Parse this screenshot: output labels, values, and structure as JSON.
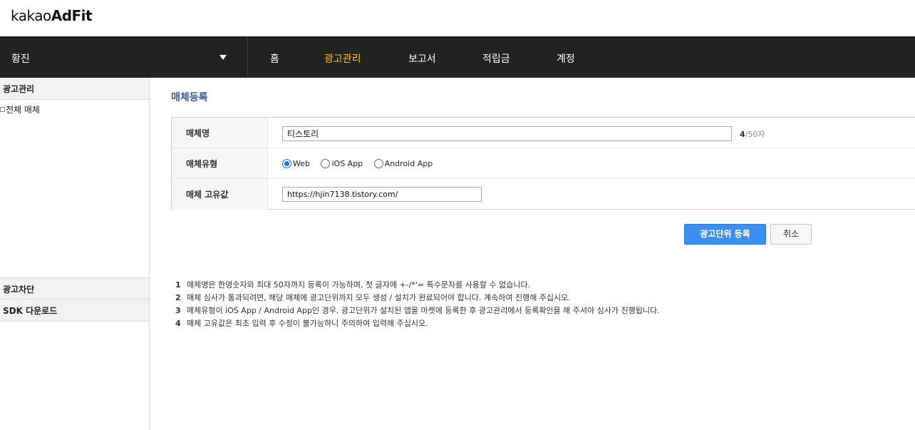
{
  "logo": {
    "prefix": "kakao",
    "brand": "AdFit"
  },
  "nav": {
    "account_name": "황진",
    "items": [
      {
        "label": "홈"
      },
      {
        "label": "광고관리",
        "active": true
      },
      {
        "label": "보고서"
      },
      {
        "label": "적립금"
      },
      {
        "label": "계정"
      }
    ],
    "active_color": "#f5c518"
  },
  "sidebar": {
    "section_ad_manage": "광고관리",
    "tree_all_media": "전체 매체",
    "section_ad_block": "광고차단",
    "section_sdk": "SDK 다운로드"
  },
  "main": {
    "page_title": "매체등록",
    "form": {
      "media_name_label": "매체명",
      "media_name_value": "티스토리",
      "counter_current": "4",
      "counter_max": "/50자",
      "media_type_label": "매체유형",
      "media_type_options": [
        {
          "label": "Web",
          "checked": true
        },
        {
          "label": "iOS App",
          "checked": false
        },
        {
          "label": "Android App",
          "checked": false
        }
      ],
      "unique_value_label": "매체 고유값",
      "unique_value": "https://hjin7138.tistory.com/"
    },
    "buttons": {
      "submit_label": "광고단위 등록",
      "cancel_label": "취소"
    },
    "notes": [
      {
        "num": "1",
        "text": "매체명은 한영숫자와 최대 50자까지 등록이 가능하며, 첫 글자에 +-/*'= 특수문자를 사용할 수 없습니다."
      },
      {
        "num": "2",
        "text": "매체 심사가 통과되려면, 해당 매체에 광고단위까지 모두 생성 / 설치가 완료되어야 합니다. 계속하여 진행해 주십시오."
      },
      {
        "num": "3",
        "text": "매체유형이 iOS App / Android App인 경우, 광고단위가 설치된 앱을 마켓에 등록한 후 광고관리에서 등록확인을 해 주셔야 심사가 진행됩니다."
      },
      {
        "num": "4",
        "text": "매체 고유값은 최초 입력 후 수정이 불가능하니 주의하여 입력해 주십시오."
      }
    ]
  },
  "colors": {
    "nav_bg": "#222222",
    "primary_button": "#3d8fef",
    "title_color": "#3a5a92"
  }
}
